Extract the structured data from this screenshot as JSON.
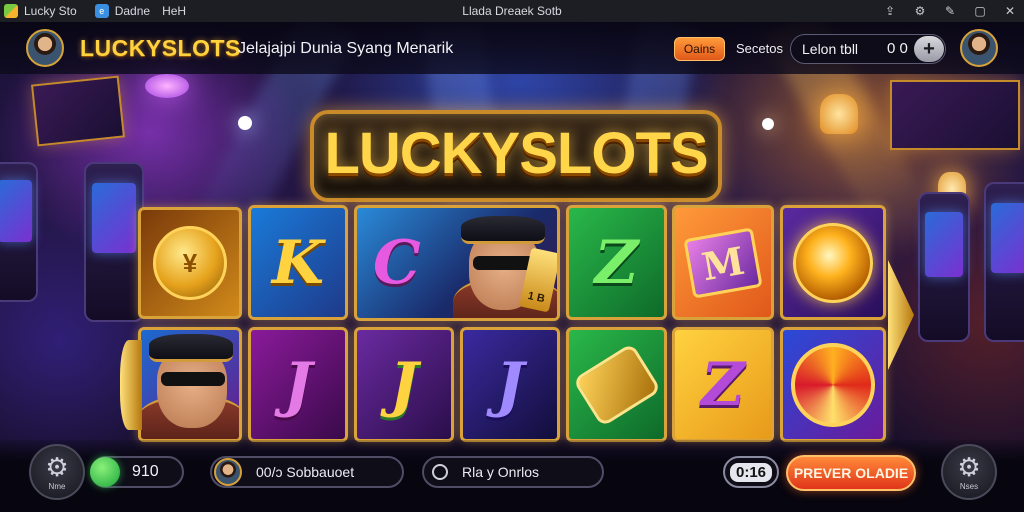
{
  "titlebar": {
    "app_name": "Lucky Sto",
    "tab_label": "Dadne",
    "tab_label_2": "HeH",
    "window_title": "Llada Dreaek Sotb",
    "controls": [
      "⇪",
      "⚙",
      "✎",
      "▢",
      "✕"
    ]
  },
  "header": {
    "brand": "LUCKYSLOTS",
    "tagline": "Jelajajpi Dunia Syang Menarik",
    "badge_label": "Oains",
    "link_label": "Secetos",
    "balance_label": "Lelon tbll",
    "balance_value": "0 0",
    "plus_label": "+"
  },
  "logo": {
    "text": "LUCKYSLOTS"
  },
  "reels": {
    "row1": [
      {
        "symbol": "coin",
        "glyph": "¥"
      },
      {
        "symbol": "letter",
        "glyph": "K"
      },
      {
        "symbol": "character-card",
        "glyph": "C",
        "card_text": "1 B"
      },
      {
        "symbol": "letter",
        "glyph": "Z"
      },
      {
        "symbol": "cube",
        "glyph": "M"
      },
      {
        "symbol": "orb"
      }
    ],
    "row2": [
      {
        "symbol": "character"
      },
      {
        "symbol": "letter",
        "glyph": "J"
      },
      {
        "symbol": "letter",
        "glyph": "J"
      },
      {
        "symbol": "letter",
        "glyph": "J"
      },
      {
        "symbol": "scroll"
      },
      {
        "symbol": "letter",
        "glyph": "Z"
      },
      {
        "symbol": "swirl"
      }
    ]
  },
  "bottom": {
    "left_btn_label": "Nme",
    "credit_value": "910",
    "player_text": "00/ɔ Sobbauoet",
    "search_text": "Rla y Onrlos",
    "bet_value": "0:16",
    "play_label": "PREVER OLADIE",
    "right_btn_label": "Nses"
  },
  "colors": {
    "accent_gold": "#ffd23f",
    "tile_border": "#d9a23a",
    "play_orange": "#e0341a",
    "badge_orange": "#ff9a3a"
  },
  "icons": {
    "left_btn": "gear-icon",
    "right_btn": "gear-icon",
    "credit_indicator": "green-dot-icon",
    "search": "search-icon"
  }
}
